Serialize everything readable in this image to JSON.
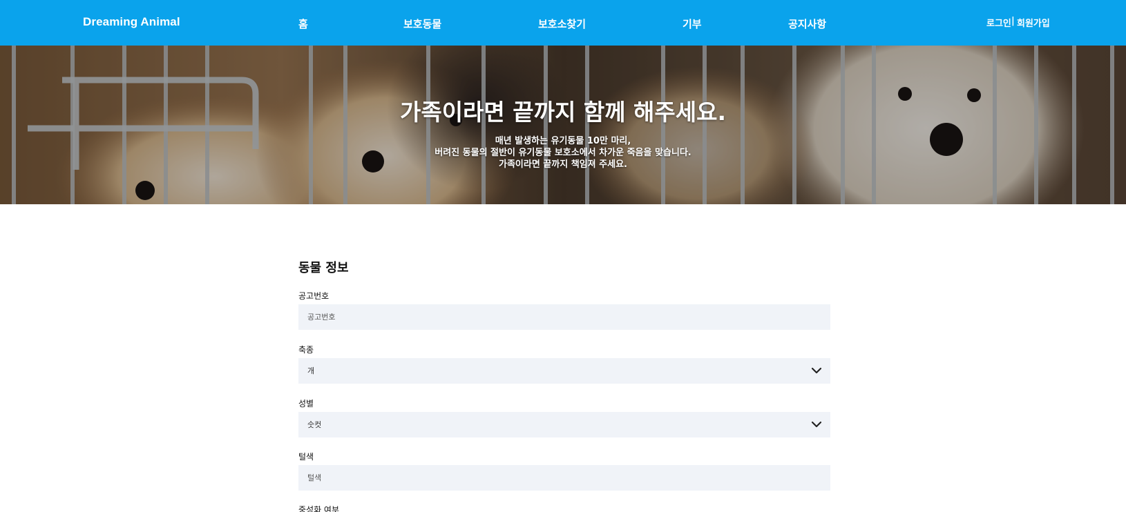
{
  "nav": {
    "brand": "Dreaming Animal",
    "items": [
      "홈",
      "보호동물",
      "보호소찾기",
      "기부",
      "공지사항"
    ],
    "login": "로그인",
    "separator": "|",
    "signup": "회원가입",
    "bar_color": "#0aa3ec"
  },
  "hero": {
    "title": "가족이라면 끝까지 함께 해주세요.",
    "lines": [
      "매년 발생하는 유기동물 10만 마리,",
      "버려진 동물의 절반이 유기동물 보호소에서  차가운 죽음을 맞습니다.",
      "가족이라면 끝까지 책임져 주세요."
    ]
  },
  "form": {
    "section_title": "동물 정보",
    "notice_no": {
      "label": "공고번호",
      "placeholder": "공고번호"
    },
    "species": {
      "label": "축종",
      "value": "개",
      "icon": "chevron-down-icon"
    },
    "sex": {
      "label": "성별",
      "value": "숫컷",
      "icon": "chevron-down-icon"
    },
    "color": {
      "label": "털색",
      "placeholder": "털색"
    },
    "neutered": {
      "label": "중성화 여부"
    }
  }
}
